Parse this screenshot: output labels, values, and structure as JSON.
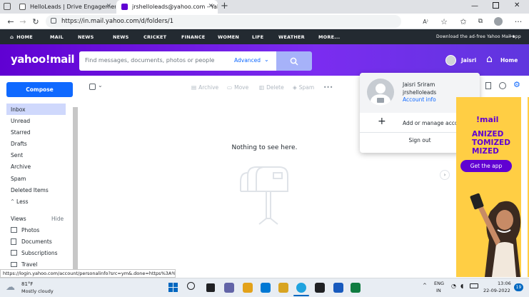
{
  "browser": {
    "tabs": [
      {
        "title": "HelloLeads | Drive Engagement",
        "active": false
      },
      {
        "title": "jrshelloleads@yahoo.com - Yaho",
        "active": true
      }
    ],
    "new_tab": "+",
    "url": "https://in.mail.yahoo.com/d/folders/1"
  },
  "yahoo_nav": {
    "items": [
      "HOME",
      "MAIL",
      "NEWS",
      "CRICKET",
      "FINANCE",
      "WOMEN",
      "LIFE",
      "WEATHER",
      "MORE..."
    ],
    "promo": "Download the ad-free Yahoo Mail app"
  },
  "header": {
    "logo": "yahoo!mail",
    "search_placeholder": "Find messages, documents, photos or people",
    "advanced_label": "Advanced",
    "user_name": "Jaisri",
    "home_label": "Home"
  },
  "sidebar": {
    "compose_label": "Compose",
    "folders": [
      "Inbox",
      "Unread",
      "Starred",
      "Drafts",
      "Sent",
      "Archive",
      "Spam",
      "Deleted Items"
    ],
    "less_label": "Less",
    "views_label": "Views",
    "hide_label": "Hide",
    "views": [
      "Photos",
      "Documents",
      "Subscriptions",
      "Travel"
    ]
  },
  "toolbar": {
    "archive": "Archive",
    "move": "Move",
    "delete": "Delete",
    "spam": "Spam",
    "more": "•••"
  },
  "main": {
    "empty_text": "Nothing to see here."
  },
  "account_menu": {
    "full_name": "Jaisri Sriram",
    "username": "jrshelloleads",
    "account_info": "Account info",
    "add_manage": "Add or manage accounts",
    "sign_out": "Sign out"
  },
  "ad": {
    "brand": "!mail",
    "lines": [
      "ANIZED",
      "TOMIZED",
      "MIZED"
    ],
    "cta": "Get the app"
  },
  "status_url": "https://login.yahoo.com/account/personalinfo?src=ym&.done=https%3A%2...",
  "taskbar": {
    "weather_temp": "81°F",
    "weather_desc": "Mostly cloudy",
    "lang_top": "ENG",
    "lang_bottom": "IN",
    "time": "13:06",
    "date": "22-09-2022",
    "notif_count": "19"
  },
  "colors": {
    "yahoo_purple": "#6001d2",
    "compose_blue": "#0f69ff",
    "nav_dark": "#232a31",
    "ad_yellow": "#ffce44"
  }
}
